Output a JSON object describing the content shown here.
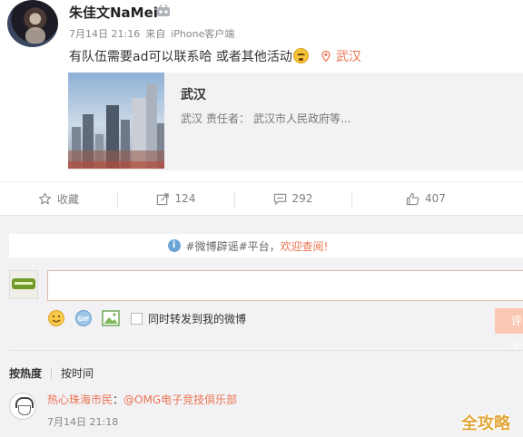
{
  "post": {
    "username": "朱佳文NaMei",
    "date": "7月14日 21:16",
    "source_prefix": "来自",
    "source": "iPhone客户端",
    "text": "有队伍需要ad可以联系哈 或者其他活动",
    "location": "武汉",
    "card": {
      "title": "武汉",
      "desc_city": "武汉",
      "desc_label": "责任者：",
      "desc_value": "武汉市人民政府等..."
    }
  },
  "actions": {
    "favorite": "收藏",
    "forward": "124",
    "comment": "292",
    "like": "407"
  },
  "comments": {
    "notice_text": "#微博辟谣#平台，",
    "notice_link": "欢迎查阅!",
    "submit_label": "评论",
    "forward_label": "同时转发到我的微博",
    "sort_hot": "按热度",
    "sort_time": "按时间",
    "first": {
      "user": "热心珠海市民",
      "colon": "：",
      "mention": "@OMG电子竞技俱乐部",
      "time": "7月14日 21:18"
    }
  },
  "watermark": "全攻略",
  "colors": {
    "accent": "#eb7350",
    "link_blue": "#6aa5d6"
  }
}
